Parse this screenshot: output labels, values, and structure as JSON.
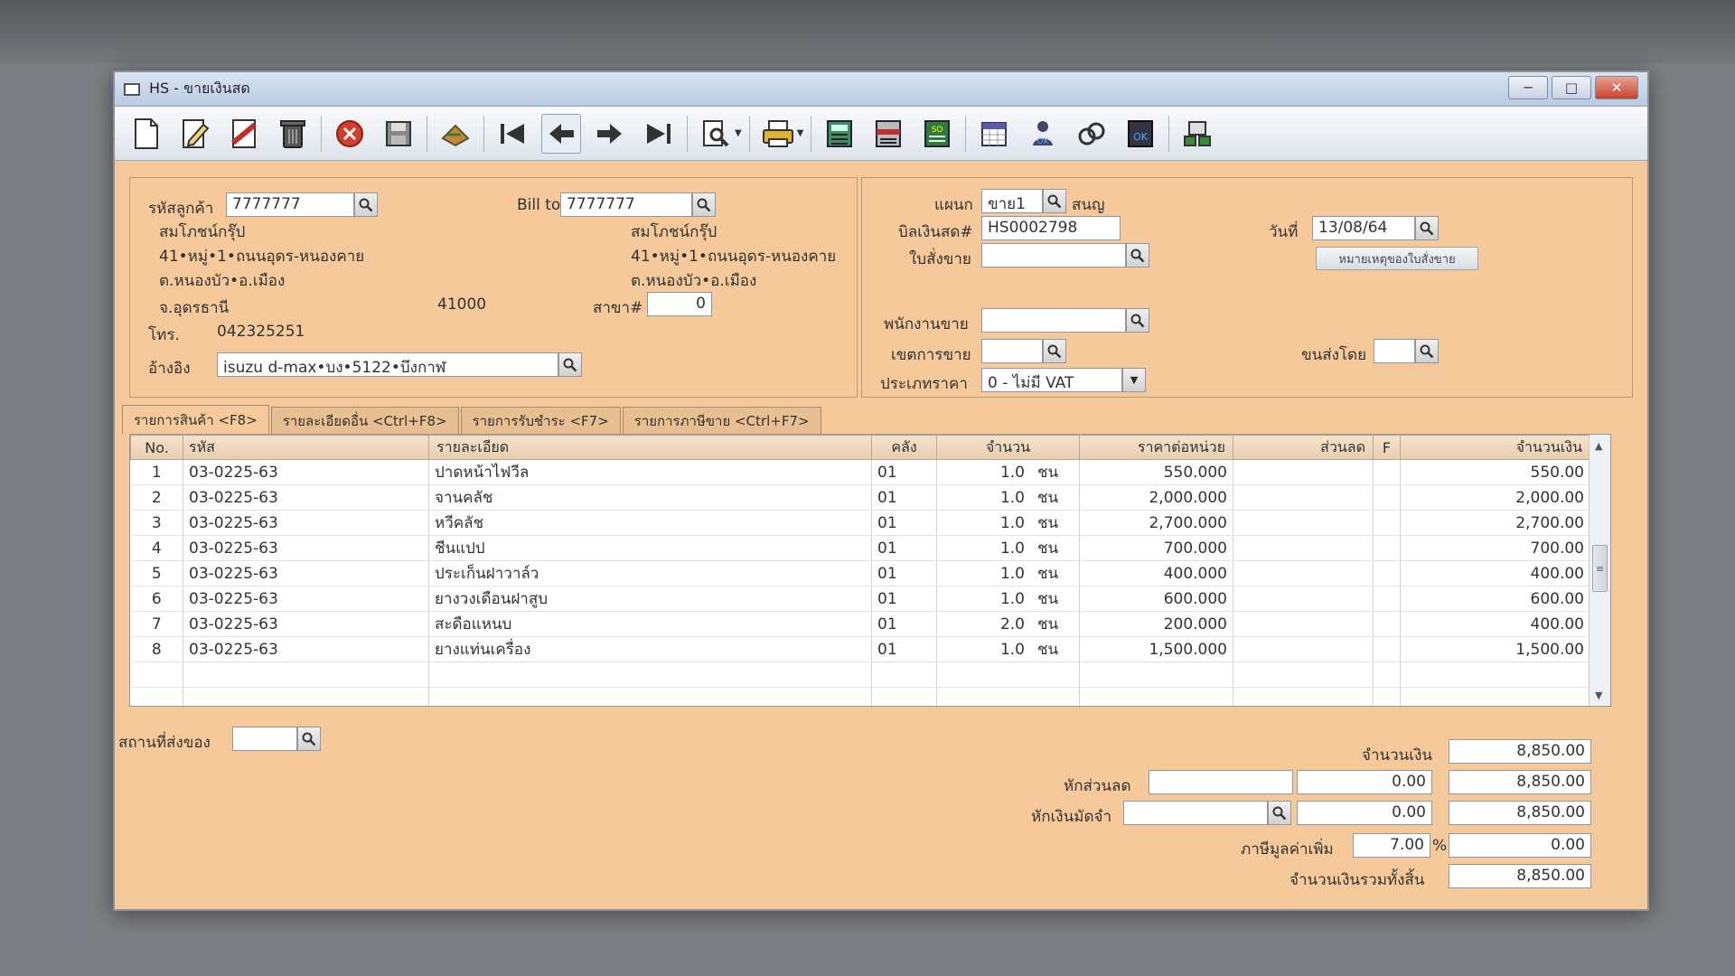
{
  "window": {
    "title": "HS - ขายเงินสด"
  },
  "form": {
    "customer_code_label": "รหัสลูกค้า",
    "customer_code": "7777777",
    "customer_name": "สมโภชน์กรุ๊ป",
    "addr1": "41•หมู่•1•ถนนอุดร-หนองคาย",
    "addr2": "ต.หนองบัว•อ.เมือง",
    "addr3": "จ.อุดรธานี",
    "postcode": "41000",
    "phone_label": "โทร.",
    "phone": "042325251",
    "ref_label": "อ้างอิง",
    "ref": "isuzu d-max•บง•5122•บึงกาฬ",
    "bill_to_label": "Bill to",
    "bill_to": "7777777",
    "bill_name": "สมโภชน์กรุ๊ป",
    "bill_addr1": "41•หมู่•1•ถนนอุดร-หนองคาย",
    "bill_addr2": "ต.หนองบัว•อ.เมือง",
    "branch_label": "สาขา#",
    "branch": "0",
    "dept_label": "แผนก",
    "dept": "ขาย1",
    "dept_name": "สนญ",
    "bill_no_label": "บิลเงินสด#",
    "bill_no": "HS0002798",
    "date_label": "วันที่",
    "date": "13/08/64",
    "order_label": "ใบสั่งขาย",
    "order": "",
    "order_note_btn": "หมายเหตุของใบสั่งขาย",
    "salesman_label": "พนักงานขาย",
    "salesman": "",
    "area_label": "เขตการขาย",
    "area": "",
    "ship_by_label": "ขนส่งโดย",
    "ship_by": "",
    "price_type_label": "ประเภทราคา",
    "price_type": "0 - ไม่มี VAT"
  },
  "tabs": [
    "รายการสินค้า <F8>",
    "รายละเอียดอื่น <Ctrl+F8>",
    "รายการรับชำระ <F7>",
    "รายการภาษีขาย <Ctrl+F7>"
  ],
  "table": {
    "headers": [
      "No.",
      "รหัส",
      "รายละเอียด",
      "คลัง",
      "จำนวน",
      "ราคาต่อหน่วย",
      "ส่วนลด",
      "F",
      "จำนวนเงิน"
    ],
    "rows": [
      {
        "no": "1",
        "code": "03-0225-63",
        "desc": "ปาดหน้าไฟวีล",
        "wh": "01",
        "qty": "1.0",
        "unit": "ชน",
        "price": "550.000",
        "disc": "",
        "f": "",
        "amount": "550.00"
      },
      {
        "no": "2",
        "code": "03-0225-63",
        "desc": "จานคลัช",
        "wh": "01",
        "qty": "1.0",
        "unit": "ชน",
        "price": "2,000.000",
        "disc": "",
        "f": "",
        "amount": "2,000.00"
      },
      {
        "no": "3",
        "code": "03-0225-63",
        "desc": "หวีคลัช",
        "wh": "01",
        "qty": "1.0",
        "unit": "ชน",
        "price": "2,700.000",
        "disc": "",
        "f": "",
        "amount": "2,700.00"
      },
      {
        "no": "4",
        "code": "03-0225-63",
        "desc": "ชีนแปป",
        "wh": "01",
        "qty": "1.0",
        "unit": "ชน",
        "price": "700.000",
        "disc": "",
        "f": "",
        "amount": "700.00"
      },
      {
        "no": "5",
        "code": "03-0225-63",
        "desc": "ประเก็นฝาวาล์ว",
        "wh": "01",
        "qty": "1.0",
        "unit": "ชน",
        "price": "400.000",
        "disc": "",
        "f": "",
        "amount": "400.00"
      },
      {
        "no": "6",
        "code": "03-0225-63",
        "desc": "ยางวงเดือนฝาสูบ",
        "wh": "01",
        "qty": "1.0",
        "unit": "ชน",
        "price": "600.000",
        "disc": "",
        "f": "",
        "amount": "600.00"
      },
      {
        "no": "7",
        "code": "03-0225-63",
        "desc": "สะดือแหนบ",
        "wh": "01",
        "qty": "2.0",
        "unit": "ชน",
        "price": "200.000",
        "disc": "",
        "f": "",
        "amount": "400.00"
      },
      {
        "no": "8",
        "code": "03-0225-63",
        "desc": "ยางแท่นเครื่อง",
        "wh": "01",
        "qty": "1.0",
        "unit": "ชน",
        "price": "1,500.000",
        "disc": "",
        "f": "",
        "amount": "1,500.00"
      }
    ]
  },
  "footer": {
    "ship_place_label": "สถานที่ส่งของ",
    "ship_place": "",
    "amount_label": "จำนวนเงิน",
    "amount": "8,850.00",
    "discount_label": "หักส่วนลด",
    "discount_text": "",
    "discount_val": "0.00",
    "after_discount": "8,850.00",
    "deposit_label": "หักเงินมัดจำ",
    "deposit_text": "",
    "deposit_val": "0.00",
    "after_deposit": "8,850.00",
    "vat_label": "ภาษีมูลค่าเพิ่ม",
    "vat_rate": "7.00",
    "vat_pct": "%",
    "vat_amount": "0.00",
    "total_label": "จำนวนเงินรวมทั้งสิ้น",
    "total": "8,850.00"
  }
}
